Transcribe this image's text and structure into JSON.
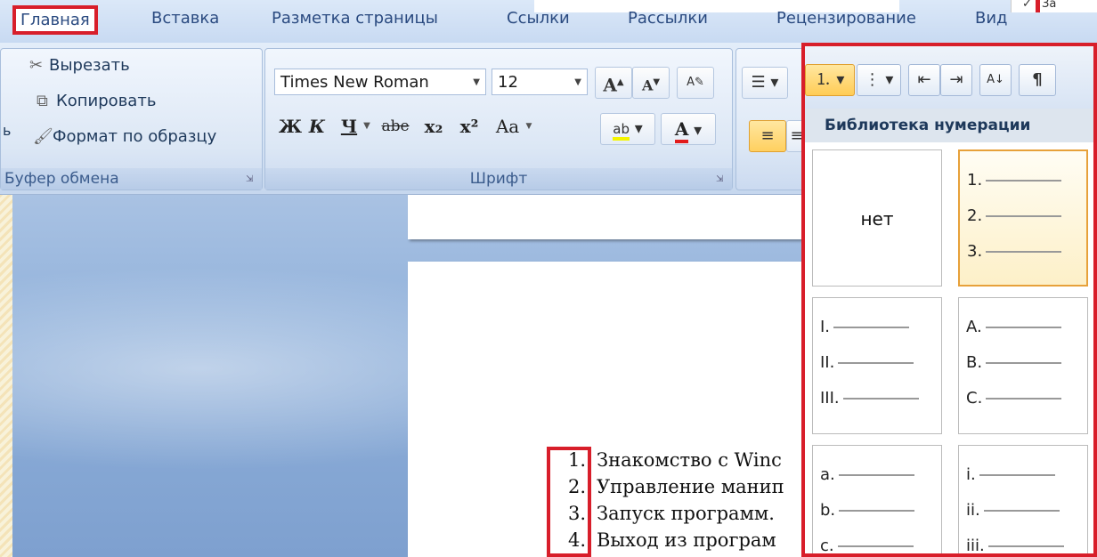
{
  "tabs": [
    "Главная",
    "Вставка",
    "Разметка страницы",
    "Ссылки",
    "Рассылки",
    "Рецензирование",
    "Вид"
  ],
  "right_top": {
    "checkmark": "✓",
    "text": "За"
  },
  "clipboard": {
    "cut": "Вырезать",
    "copy": "Копировать",
    "format_painter": "Формат по образцу",
    "group_label": "Буфер обмена",
    "edge_char": "ь"
  },
  "font": {
    "name": "Times New Roman",
    "size": "12",
    "group_label": "Шрифт",
    "grow_label": "A",
    "shrink_label": "A",
    "bold": "Ж",
    "italic": "К",
    "underline": "Ч",
    "strike": "abe",
    "subscript": "x₂",
    "superscript": "x²",
    "case": "Aa",
    "highlight": "ab",
    "color": "A"
  },
  "gallery": {
    "title": "Библиотека нумерации",
    "cells": [
      {
        "type": "none",
        "label": "нет"
      },
      {
        "type": "list",
        "items": [
          "1.",
          "2.",
          "3."
        ]
      },
      {
        "type": "list",
        "items": [
          "I.",
          "II.",
          "III."
        ]
      },
      {
        "type": "list",
        "items": [
          "A.",
          "B.",
          "C."
        ]
      },
      {
        "type": "list",
        "items": [
          "a.",
          "b.",
          "c."
        ]
      },
      {
        "type": "list",
        "items": [
          "i.",
          "ii.",
          "iii."
        ]
      }
    ],
    "toolbar_pilcrow": "¶"
  },
  "document": {
    "list": [
      {
        "num": "1.",
        "text": "Знакомство с Winc"
      },
      {
        "num": "2.",
        "text": "Управление манип"
      },
      {
        "num": "3.",
        "text": "Запуск программ."
      },
      {
        "num": "4.",
        "text": "Выход из програм"
      }
    ]
  },
  "colors": {
    "highlight_red": "#d81e2a",
    "accent_blue": "#1e395b"
  }
}
